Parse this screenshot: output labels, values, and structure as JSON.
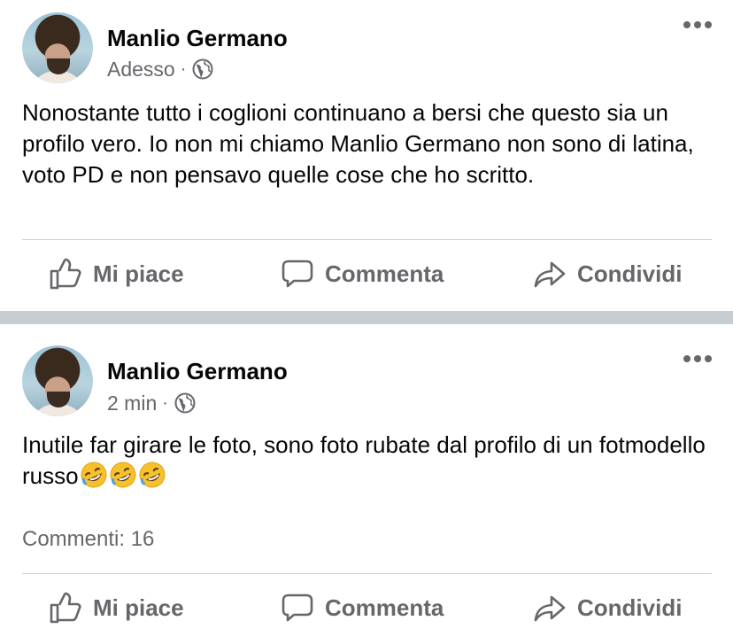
{
  "posts": [
    {
      "author": "Manlio Germano",
      "time": "Adesso",
      "separator": "·",
      "text": "Nonostante tutto i coglioni continuano a bersi che questo sia un profilo vero. Io non mi chiamo Manlio Germano non sono di latina, voto PD e non pensavo quelle cose che ho scritto.",
      "actions": {
        "like": "Mi piace",
        "comment": "Commenta",
        "share": "Condividi"
      }
    },
    {
      "author": "Manlio Germano",
      "time": "2 min",
      "separator": "·",
      "text": "Inutile far girare le foto, sono foto rubate dal profilo di un fotmodello russo",
      "emoji": [
        "rolling-on-floor-laughing",
        "rolling-on-floor-laughing",
        "rolling-on-floor-laughing"
      ],
      "comments_count": "Commenti: 16",
      "actions": {
        "like": "Mi piace",
        "comment": "Commenta",
        "share": "Condividi"
      }
    }
  ],
  "icons": {
    "privacy": "globe-icon",
    "more": "more-options-icon",
    "like": "thumbs-up-icon",
    "comment": "speech-bubble-icon",
    "share": "share-arrow-icon"
  },
  "colors": {
    "text": "#050505",
    "secondary": "#65676b",
    "divider": "#ced0d4",
    "separator": "#c9ccd1"
  }
}
